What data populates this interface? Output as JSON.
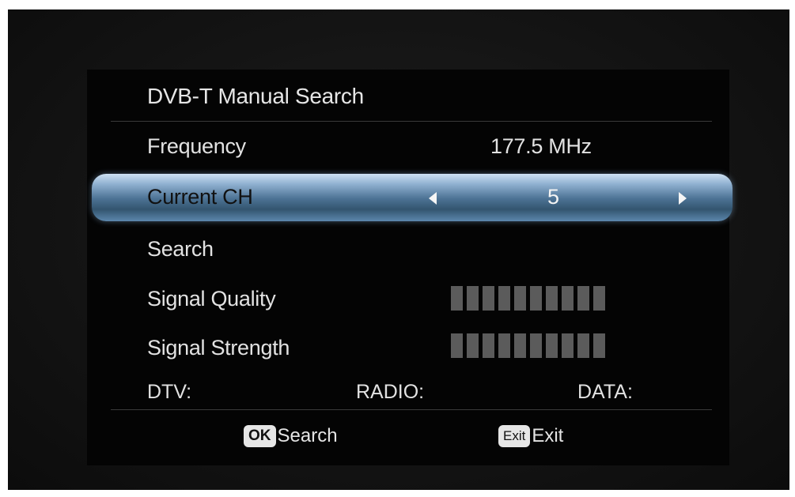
{
  "menu": {
    "title": "DVB-T Manual Search",
    "frequency": {
      "label": "Frequency",
      "value": "177.5 MHz"
    },
    "current_ch": {
      "label": "Current CH",
      "value": "5"
    },
    "search": {
      "label": "Search"
    },
    "signal_quality": {
      "label": "Signal Quality",
      "segments": 10
    },
    "signal_strength": {
      "label": "Signal Strength",
      "segments": 10
    },
    "counts": {
      "dtv": "DTV:",
      "radio": "RADIO:",
      "data": "DATA:"
    }
  },
  "footer": {
    "ok_badge": "OK",
    "ok_label": "Search",
    "exit_badge": "Exit",
    "exit_label": "Exit"
  },
  "colors": {
    "highlight": "#4d7395",
    "meter_segment": "#5b5b5b",
    "text": "#e2e2e2"
  }
}
